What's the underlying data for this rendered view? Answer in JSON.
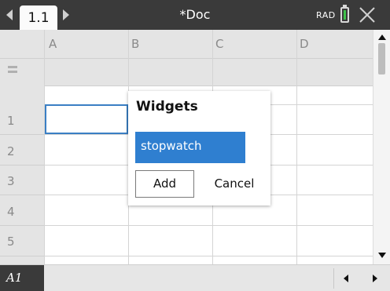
{
  "topbar": {
    "tab_label": "1.1",
    "doc_title": "*Doc",
    "angle_mode": "RAD",
    "battery_color": "#3ec24a"
  },
  "sheet": {
    "columns": [
      "A",
      "B",
      "C",
      "D"
    ],
    "rows": [
      "1",
      "2",
      "3",
      "4",
      "5"
    ],
    "selected_cell": "A1",
    "selection_color": "#3a7fc4"
  },
  "popup": {
    "title": "Widgets",
    "items": [
      "stopwatch"
    ],
    "selected_item_color": "#2f7fd0",
    "add_label": "Add",
    "cancel_label": "Cancel"
  },
  "statusbar": {
    "cell_reference": "A1"
  }
}
